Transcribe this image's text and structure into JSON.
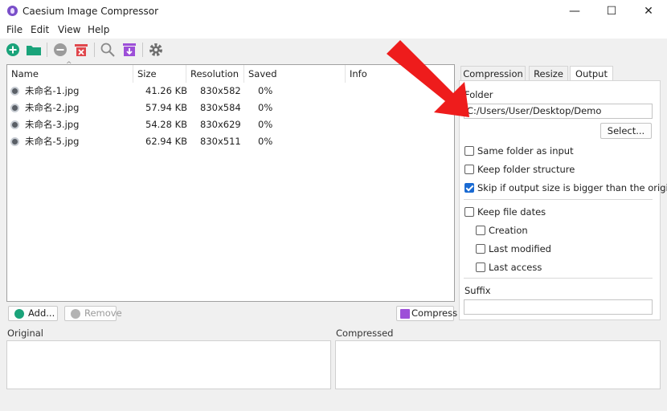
{
  "window": {
    "title": "Caesium Image Compressor",
    "controls": {
      "minimize": "—",
      "maximize": "☐",
      "close": "✕"
    }
  },
  "menu": [
    "File",
    "Edit",
    "View",
    "Help"
  ],
  "toolbar": {
    "icons": [
      "add-icon",
      "open-folder-icon",
      "remove-icon",
      "clear-list-icon",
      "search-icon",
      "compress-icon",
      "settings-icon"
    ]
  },
  "table": {
    "headers": [
      "Name",
      "Size",
      "Resolution",
      "Saved",
      "Info"
    ],
    "rows": [
      {
        "name": "未命名-1.jpg",
        "size": "41.26 KB",
        "resolution": "830x582",
        "saved": "0%"
      },
      {
        "name": "未命名-2.jpg",
        "size": "57.94 KB",
        "resolution": "830x584",
        "saved": "0%"
      },
      {
        "name": "未命名-3.jpg",
        "size": "54.28 KB",
        "resolution": "830x629",
        "saved": "0%"
      },
      {
        "name": "未命名-5.jpg",
        "size": "62.94 KB",
        "resolution": "830x511",
        "saved": "0%"
      }
    ]
  },
  "buttons": {
    "add": "Add...",
    "remove": "Remove",
    "compress": "Compress"
  },
  "preview": {
    "original": "Original",
    "compressed": "Compressed"
  },
  "tabs": [
    "Compression",
    "Resize",
    "Output"
  ],
  "output": {
    "folder_label": "Folder",
    "folder_value": "C:/Users/User/Desktop/Demo",
    "select_label": "Select...",
    "same_folder": "Same folder as input",
    "keep_structure": "Keep folder structure",
    "skip_bigger": "Skip if output size is bigger than the original",
    "keep_dates": "Keep file dates",
    "creation": "Creation",
    "last_modified": "Last modified",
    "last_access": "Last access",
    "suffix_label": "Suffix",
    "suffix_value": ""
  },
  "colors": {
    "accent": "#1a6ad2",
    "add_green": "#1aa37a",
    "clear_red": "#e0474c",
    "compress_purple": "#9d4fd8",
    "arrow_red": "#ee1c1c"
  }
}
